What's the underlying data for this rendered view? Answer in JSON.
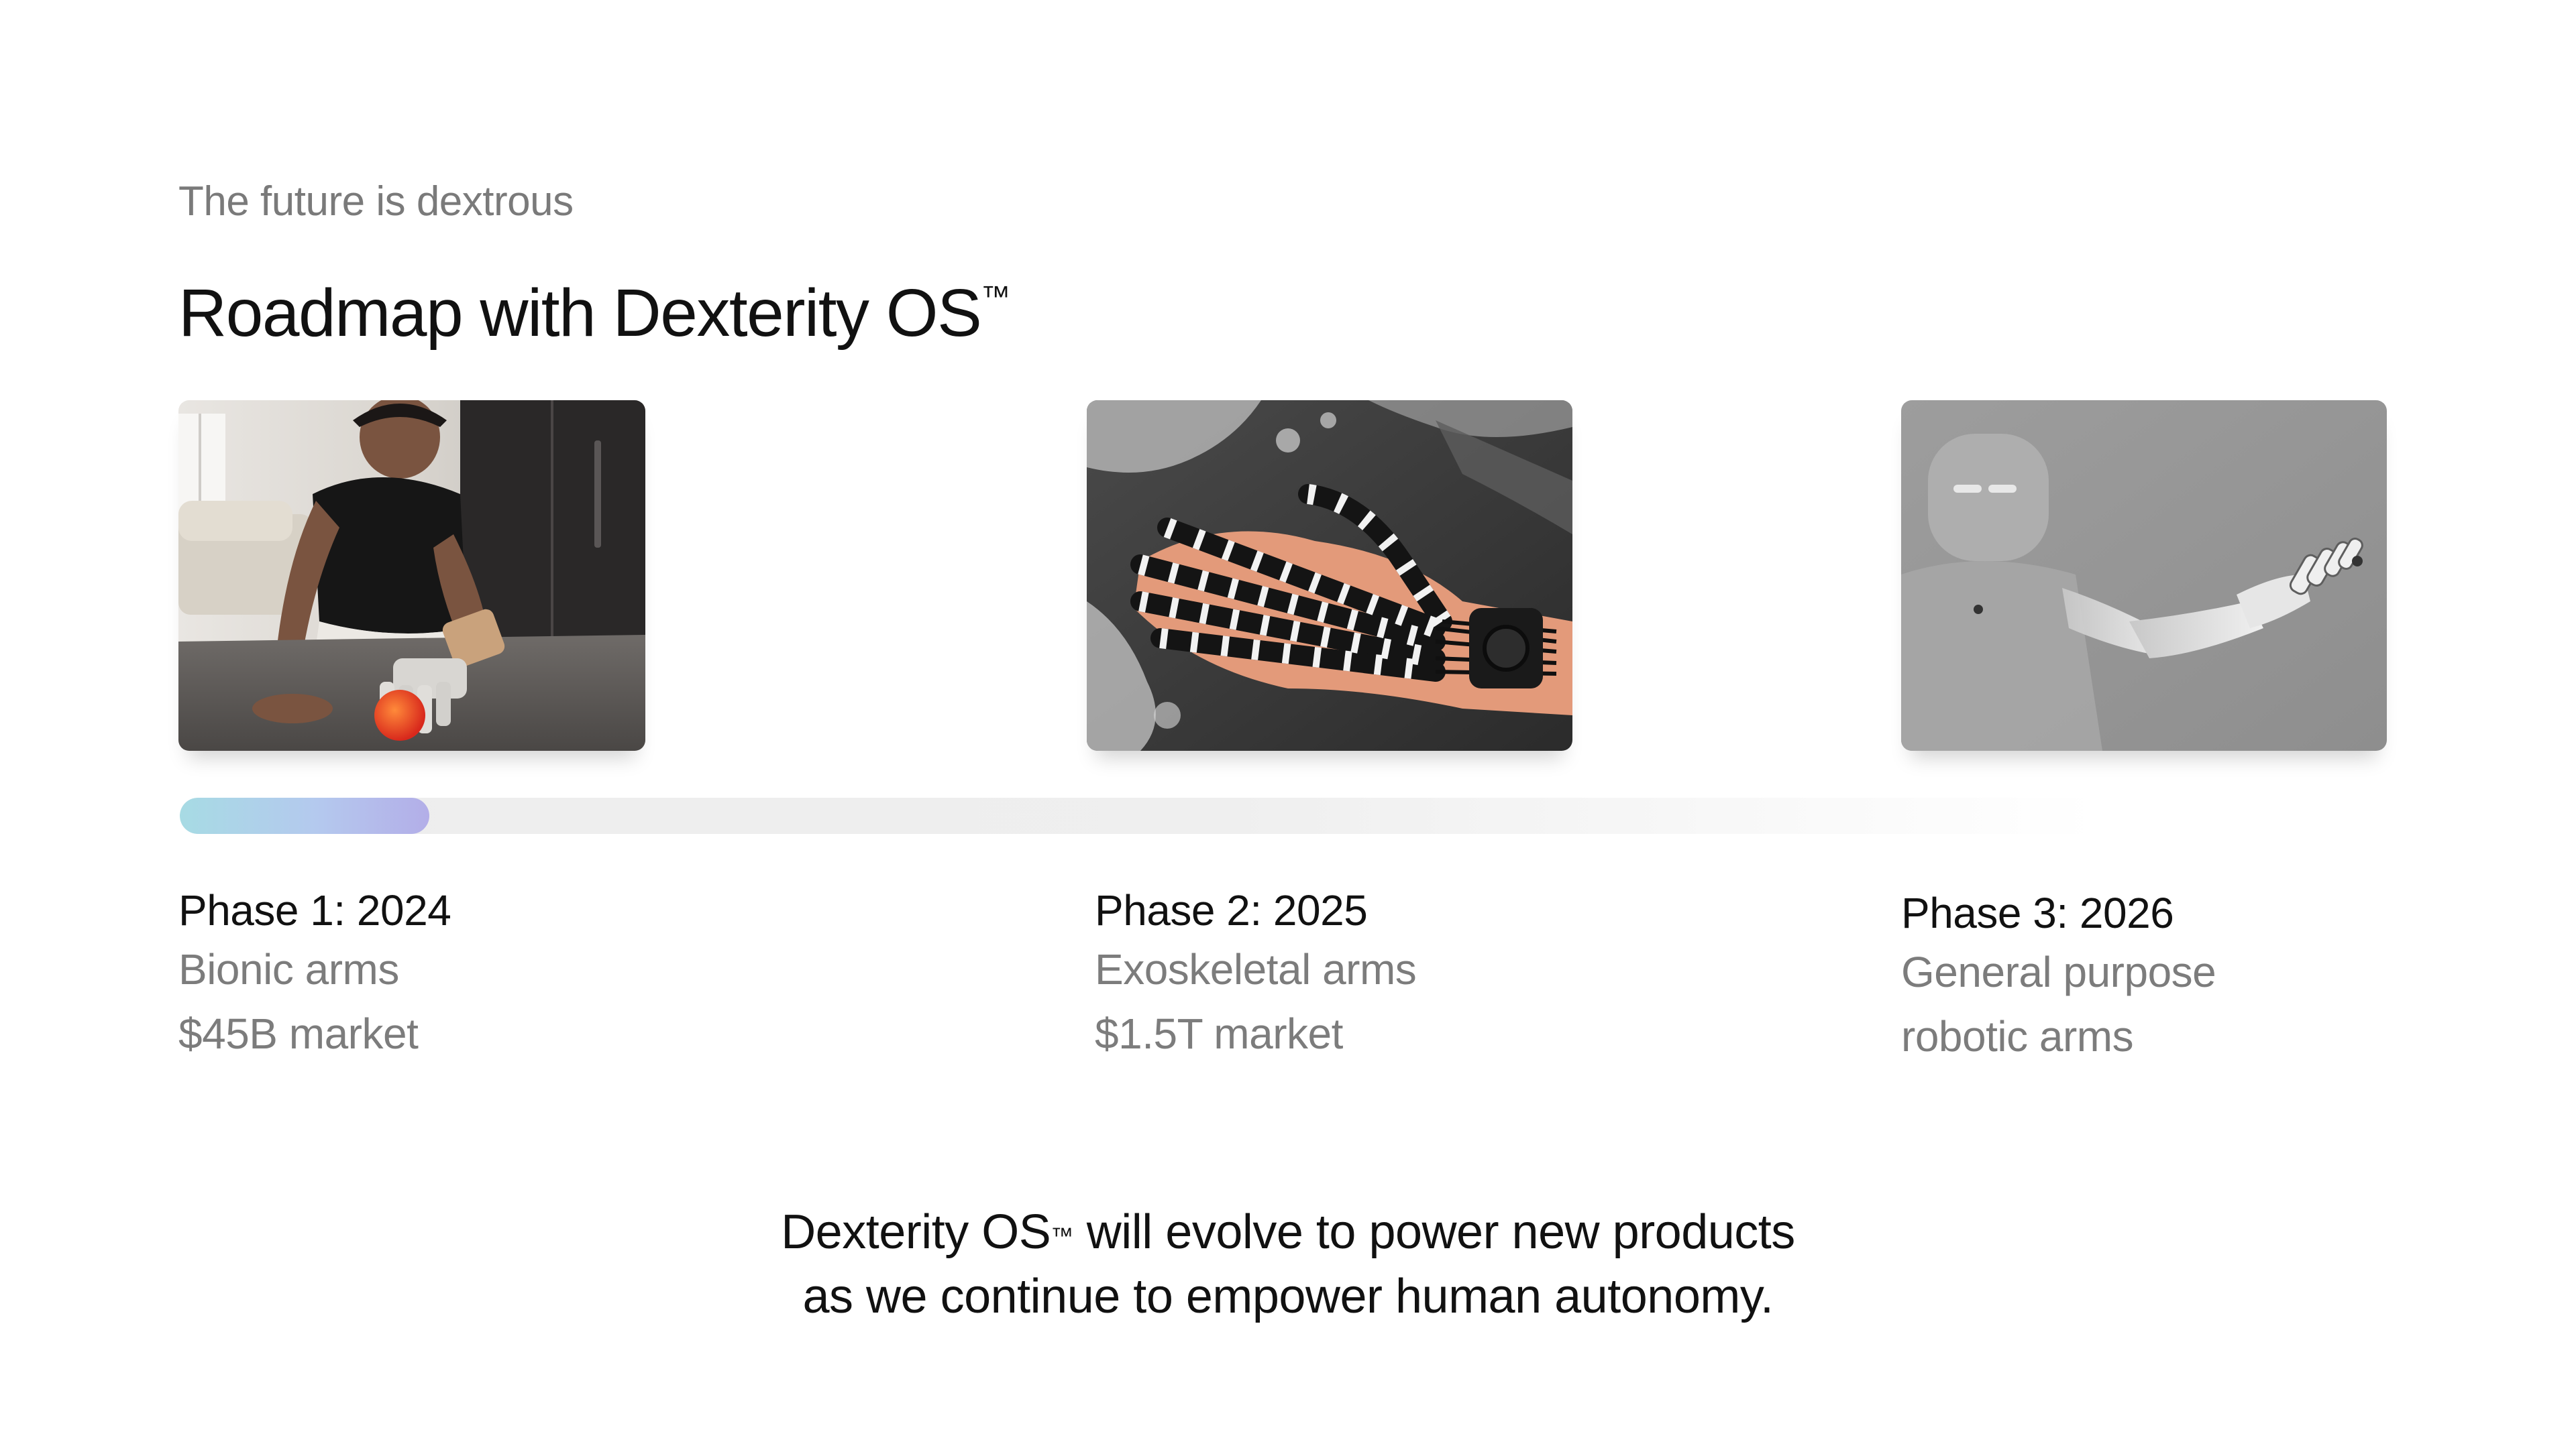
{
  "header": {
    "eyebrow": "The future is dextrous",
    "title": "Roadmap with Dexterity OS",
    "title_trademark": "™"
  },
  "progress": {
    "fill_fraction": 0.13,
    "fill_gradient": [
      "#a7dbe4",
      "#b4c9ee",
      "#b3aee8"
    ],
    "track_color": "#ededed"
  },
  "phases": [
    {
      "title": "Phase 1: 2024",
      "line1": "Bionic arms",
      "line2": "$45B market",
      "image": "person-with-bionic-arm-photo"
    },
    {
      "title": "Phase 2: 2025",
      "line1": "Exoskeletal arms",
      "line2": "$1.5T market",
      "image": "exoskeletal-glove-photo"
    },
    {
      "title": "Phase 3: 2026",
      "line1": "General purpose",
      "line2": "robotic arms",
      "image": "humanoid-robot-arm-photo"
    }
  ],
  "closing": {
    "line1_before_tm": "Dexterity OS",
    "trademark": "™",
    "line1_after_tm": " will evolve to power new products",
    "line2": "as we continue to empower human autonomy."
  }
}
